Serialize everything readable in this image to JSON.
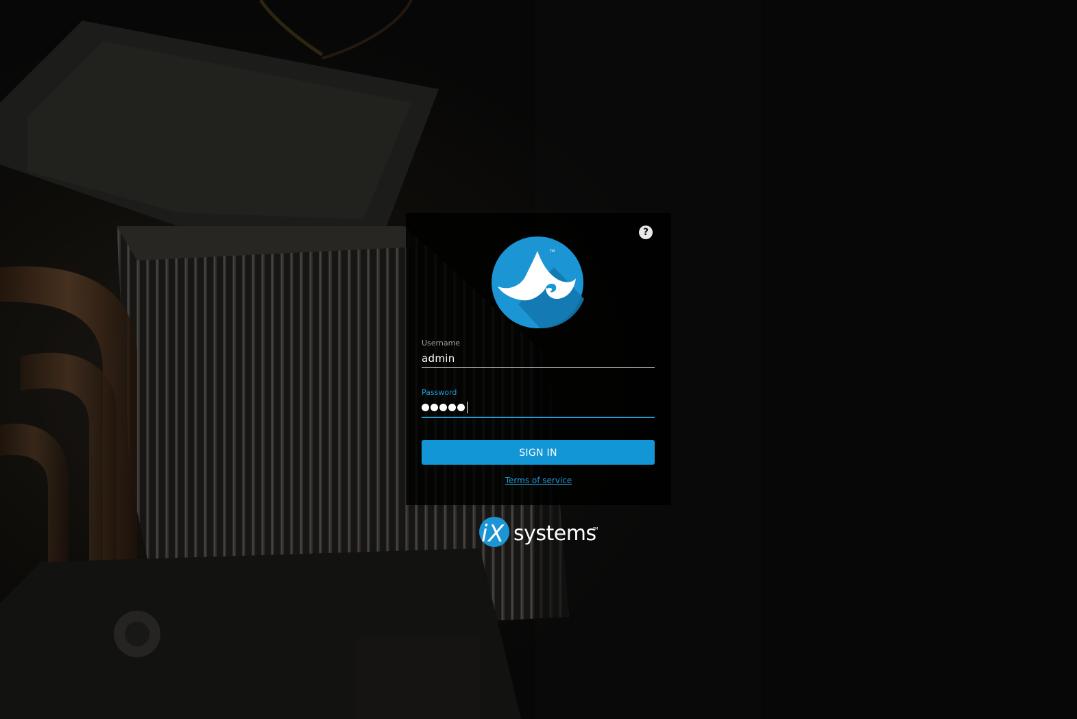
{
  "login": {
    "username_label": "Username",
    "username_value": "admin",
    "password_label": "Password",
    "password_mask_count": 5,
    "signin_label": "SIGN IN",
    "terms_label": "Terms of service",
    "help_glyph": "?"
  },
  "branding": {
    "product_logo": "freenas-logo",
    "vendor_logo_text": "systems",
    "vendor_logo_prefix": "iX"
  },
  "colors": {
    "accent": "#1296d6",
    "card_bg": "#000000",
    "text": "#ffffff"
  },
  "icons": {
    "help": "help-circle-icon"
  }
}
